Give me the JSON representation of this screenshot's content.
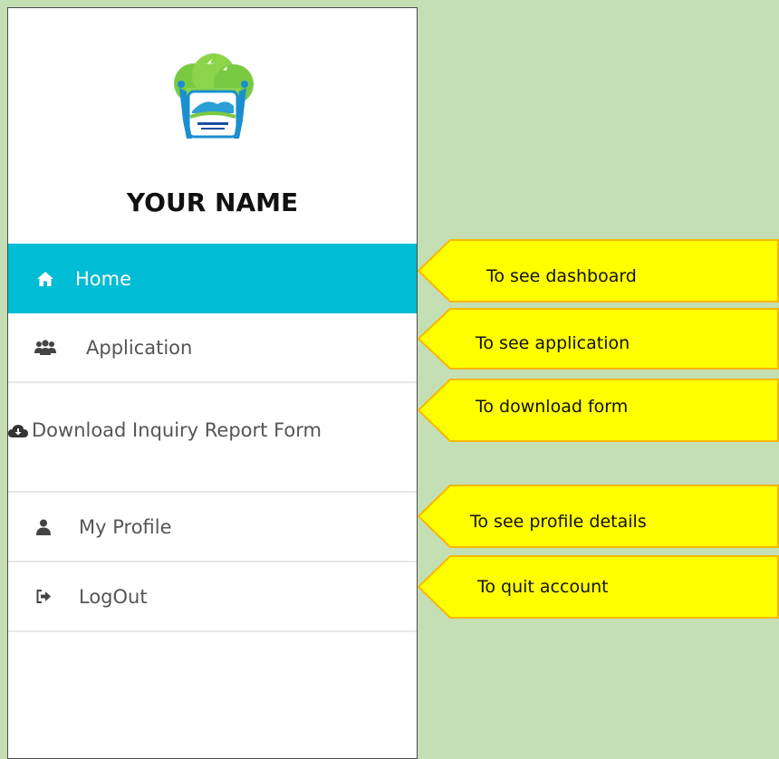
{
  "sidebar": {
    "user_name": "YOUR NAME",
    "logo_icon": "logo-emblem-icon",
    "nav": [
      {
        "label": "Home",
        "icon": "home-icon",
        "active": true
      },
      {
        "label": "Application",
        "icon": "users-icon",
        "active": false
      },
      {
        "label": "Download Inquiry Report Form",
        "icon": "cloud-download-icon",
        "active": false
      },
      {
        "label": "My Profile",
        "icon": "user-icon",
        "active": false
      },
      {
        "label": "LogOut",
        "icon": "sign-out-icon",
        "active": false
      }
    ]
  },
  "callouts": [
    {
      "text": "To see dashboard"
    },
    {
      "text": "To see application"
    },
    {
      "text": "To download form"
    },
    {
      "text": "To see profile details"
    },
    {
      "text": "To quit account"
    }
  ],
  "colors": {
    "background": "#c5dfb4",
    "active_nav": "#00bcd4",
    "callout_fill": "#ffff00",
    "callout_border": "#f5b800"
  }
}
